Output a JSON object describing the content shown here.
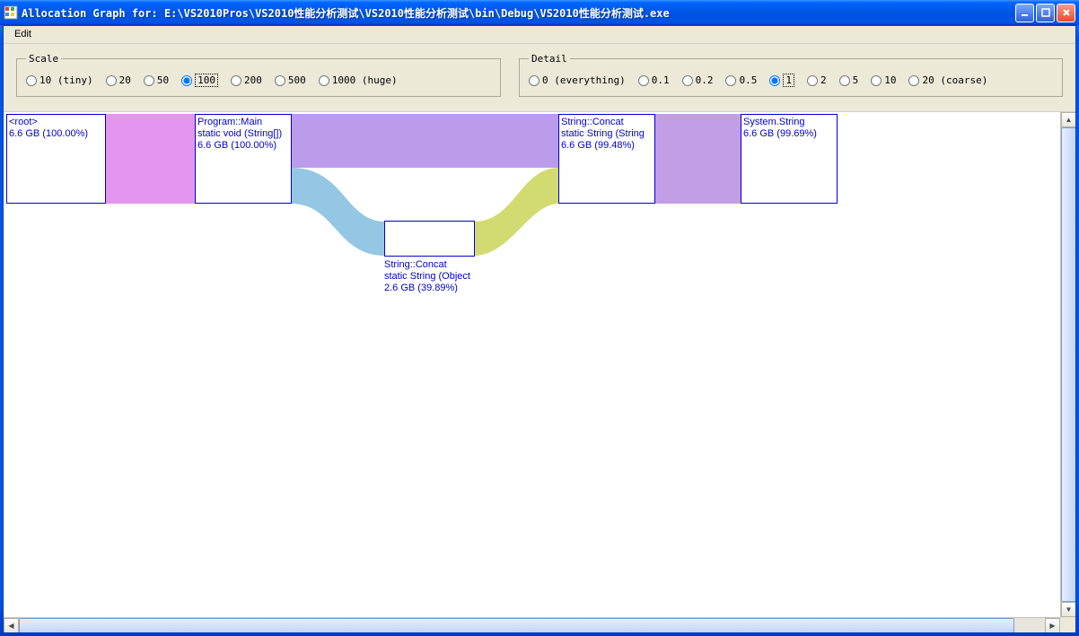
{
  "window": {
    "title": "Allocation Graph for:  E:\\VS2010Pros\\VS2010性能分析测试\\VS2010性能分析测试\\bin\\Debug\\VS2010性能分析测试.exe"
  },
  "menubar": {
    "edit": "Edit"
  },
  "scale": {
    "legend": "Scale",
    "options": [
      {
        "label": "10 (tiny)",
        "value": 10,
        "selected": false
      },
      {
        "label": "20",
        "value": 20,
        "selected": false
      },
      {
        "label": "50",
        "value": 50,
        "selected": false
      },
      {
        "label": "100",
        "value": 100,
        "selected": true
      },
      {
        "label": "200",
        "value": 200,
        "selected": false
      },
      {
        "label": "500",
        "value": 500,
        "selected": false
      },
      {
        "label": "1000 (huge)",
        "value": 1000,
        "selected": false
      }
    ]
  },
  "detail": {
    "legend": "Detail",
    "options": [
      {
        "label": "0 (everything)",
        "value": 0,
        "selected": false
      },
      {
        "label": "0.1",
        "value": 0.1,
        "selected": false
      },
      {
        "label": "0.2",
        "value": 0.2,
        "selected": false
      },
      {
        "label": "0.5",
        "value": 0.5,
        "selected": false
      },
      {
        "label": "1",
        "value": 1,
        "selected": true
      },
      {
        "label": "2",
        "value": 2,
        "selected": false
      },
      {
        "label": "5",
        "value": 5,
        "selected": false
      },
      {
        "label": "10",
        "value": 10,
        "selected": false
      },
      {
        "label": "20 (coarse)",
        "value": 20,
        "selected": false
      }
    ]
  },
  "nodes": {
    "root": {
      "line1": "<root>",
      "line2": " 6.6 GB    (100.00%)"
    },
    "main": {
      "line1": "Program::Main",
      "line2": "static void (String[])",
      "line3": "  6.6 GB    (100.00%)"
    },
    "concat_str": {
      "line1": "String::Concat",
      "line2": "static String (String",
      "line3": "  6.6 GB    (99.48%)"
    },
    "system_str": {
      "line1": "System.String",
      "line2": "  6.6 GB    (99.69%)"
    },
    "concat_obj": {
      "line1": "String::Concat",
      "line2": "static String (Object",
      "line3": "  2.6 GB    (39.89%)"
    }
  },
  "flow_colors": {
    "root_main": "#e496ee",
    "main_concat": "#bb9cec",
    "main_obj": "#93c7e4",
    "obj_concat": "#d2db72",
    "concat_sys": "#c19ee6"
  }
}
